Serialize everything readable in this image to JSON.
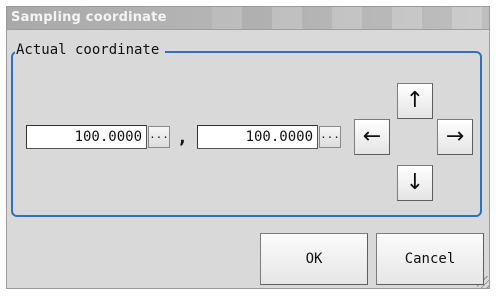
{
  "dialog": {
    "title": "Sampling coordinate",
    "group_label": "Actual coordinate",
    "x_value": "100.0000",
    "y_value": "100.0000",
    "ellipsis_label": "...",
    "separator": ",",
    "arrows": {
      "up": "↑",
      "left": "←",
      "right": "→",
      "down": "↓"
    },
    "ok_label": "OK",
    "cancel_label": "Cancel"
  },
  "colors": {
    "group_border": "#2f70c0",
    "background": "#d9d9d9",
    "titlebar": "#a9a9a9"
  }
}
